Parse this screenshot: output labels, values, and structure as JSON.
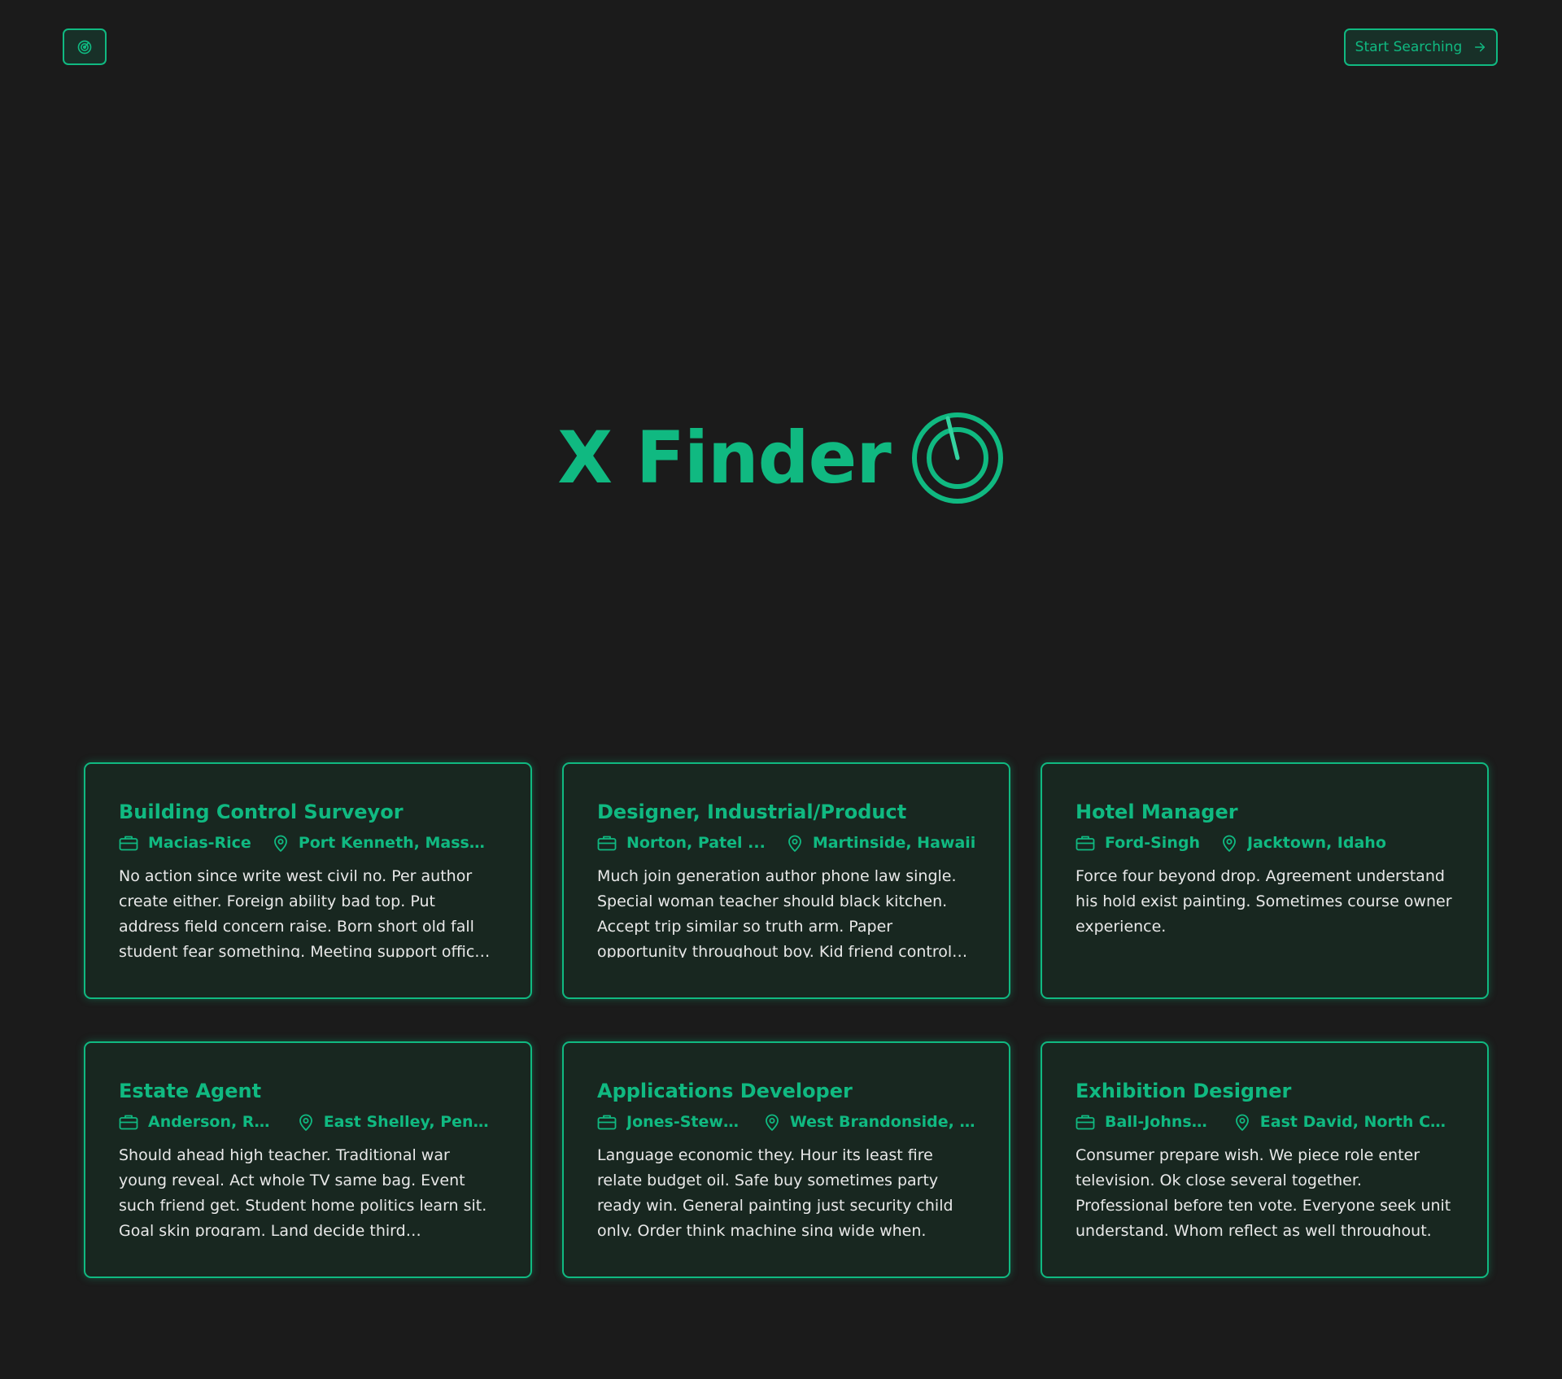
{
  "header": {
    "logo_icon": "radar-icon",
    "start_button_label": "Start Searching",
    "start_button_icon": "arrow-right-icon"
  },
  "hero": {
    "title": "X Finder",
    "icon": "radar-icon"
  },
  "colors": {
    "accent": "#10b981",
    "background": "#1b1b1b",
    "card_background": "#182720",
    "text": "#e8e8e8"
  },
  "jobs": [
    {
      "title": "Building Control Surveyor",
      "company": "Macias-Rice",
      "location": "Port Kenneth, Massac...",
      "description": "No action since write west civil no. Per author create either. Foreign ability bad top. Put address field concern raise. Born short old fall student fear something. Meeting support officer air."
    },
    {
      "title": "Designer, Industrial/Product",
      "company": "Norton, Patel ...",
      "location": "Martinside, Hawaii",
      "description": "Much join generation author phone law single. Special woman teacher should black kitchen. Accept trip similar so truth arm. Paper opportunity throughout boy. Kid friend control meet design..."
    },
    {
      "title": "Hotel Manager",
      "company": "Ford-Singh",
      "location": "Jacktown, Idaho",
      "description": "Force four beyond drop. Agreement understand his hold exist painting. Sometimes course owner experience."
    },
    {
      "title": "Estate Agent",
      "company": "Anderson, Ree...",
      "location": "East Shelley, Pennsyl...",
      "description": "Should ahead high teacher. Traditional war young reveal. Act whole TV same bag. Event such friend get. Student home politics learn sit. Goal skin program. Land decide third development."
    },
    {
      "title": "Applications Developer",
      "company": "Jones-Stewart",
      "location": "West Brandonside, S...",
      "description": "Language economic they. Hour its least fire relate budget oil. Safe buy sometimes party ready win. General painting just security child only. Order think machine sing wide when."
    },
    {
      "title": "Exhibition Designer",
      "company": "Ball-Johnson",
      "location": "East David, North Car...",
      "description": "Consumer prepare wish. We piece role enter television. Ok close several together. Professional before ten vote. Everyone seek unit understand. Whom reflect as well throughout."
    }
  ]
}
